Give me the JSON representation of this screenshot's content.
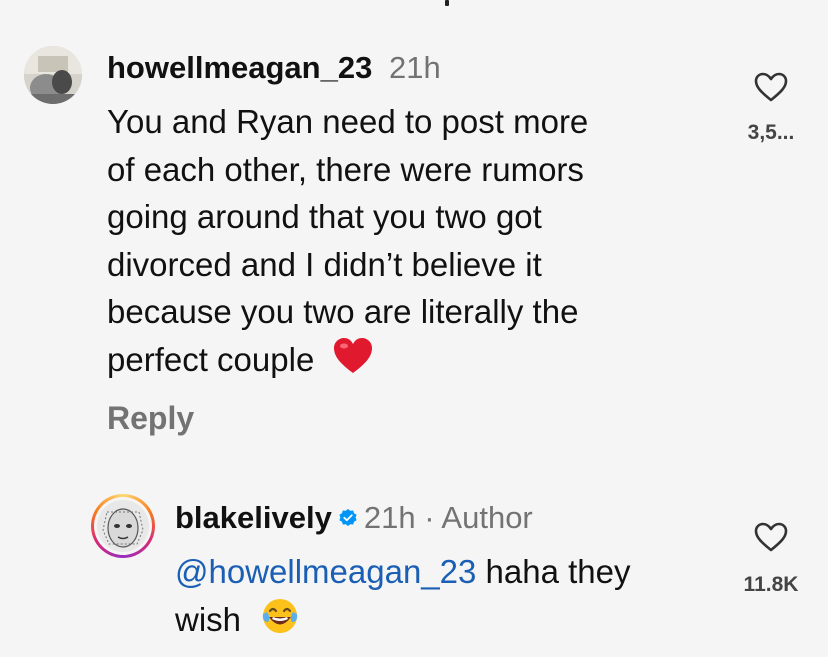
{
  "comments": [
    {
      "username": "howellmeagan_23",
      "time": "21h",
      "text_lines": [
        "You and Ryan need to post more",
        "of each other, there were rumors",
        "going around that you two got",
        "divorced and I didn’t believe it",
        "because you two are literally the",
        "perfect couple"
      ],
      "emoji": "❤️",
      "reply_label": "Reply",
      "likes": "3,5..."
    },
    {
      "username": "blakelively",
      "time": "21h",
      "separator": " · ",
      "author_tag": "Author",
      "mention": "@howellmeagan_23",
      "text_line1_rest": " haha they",
      "text_line2": "wish",
      "emoji": "😂",
      "likes": "11.8K"
    }
  ],
  "icons": {
    "like": "heart-outline-icon",
    "verified": "verified-badge-icon"
  },
  "colors": {
    "background": "#f5f5f5",
    "mention": "#1a5fb4",
    "meta": "#737373",
    "verified": "#0095f6",
    "heart_emoji": "#e0192f"
  }
}
